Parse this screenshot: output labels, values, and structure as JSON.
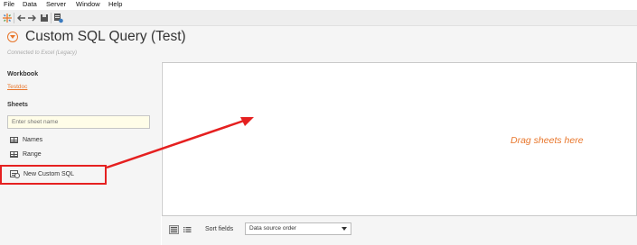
{
  "menu": [
    "File",
    "Data",
    "Server",
    "Window",
    "Help"
  ],
  "toolbar": {
    "icons": [
      "tableau-logo-icon",
      "back-arrow-icon",
      "forward-arrow-icon",
      "save-icon",
      "add-datasource-icon"
    ]
  },
  "header": {
    "title": "Custom SQL Query (Test)",
    "connection_status": "Connected to Excel (Legacy)"
  },
  "sidebar": {
    "workbook_header": "Workbook",
    "workbook_name": "Testdoc",
    "sheets_header": "Sheets",
    "search_placeholder": "Enter sheet name",
    "items": [
      {
        "label": "Names",
        "icon": "table-icon"
      },
      {
        "label": "Range",
        "icon": "table-icon"
      },
      {
        "label": "New Custom SQL",
        "icon": "custom-sql-icon"
      }
    ]
  },
  "canvas": {
    "hint": "Drag sheets here"
  },
  "grid_controls": {
    "sort_label": "Sort fields",
    "sort_value": "Data source order"
  },
  "colors": {
    "accent": "#e8762b",
    "annotation": "#e52020"
  }
}
